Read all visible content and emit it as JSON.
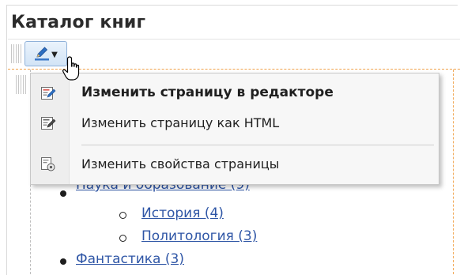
{
  "page": {
    "title": "Каталог книг"
  },
  "menu": {
    "items": [
      {
        "label": "Изменить страницу в редакторе",
        "icon": "edit-page-wysiwyg-icon"
      },
      {
        "label": "Изменить страницу как HTML",
        "icon": "edit-page-html-icon"
      },
      {
        "label": "Изменить свойства страницы",
        "icon": "page-properties-icon"
      }
    ]
  },
  "list": {
    "partial_item": "Наука и образование (9)",
    "sub_items": [
      "История (4)",
      "Политология (3)"
    ],
    "next_item": "Фантастика (3)"
  },
  "colors": {
    "link": "#2f56a6",
    "accent_dashed": "#f0a24a",
    "button_border": "#8fb1d9"
  }
}
